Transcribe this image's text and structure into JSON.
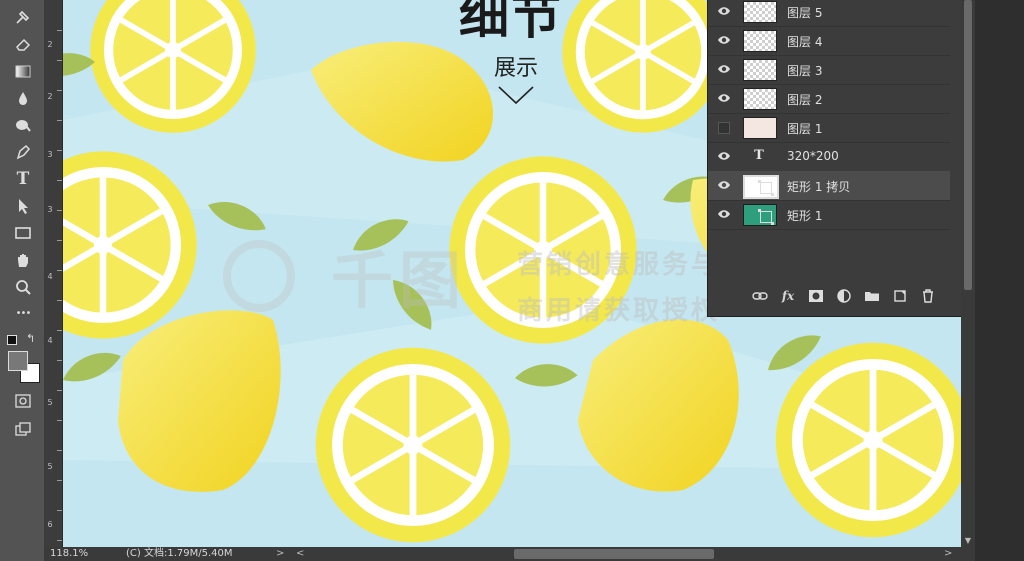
{
  "canvas": {
    "headline": "细节",
    "subline": "展示",
    "watermark_main": "千图",
    "watermark_sub1": "营销创意服务与协作平台",
    "watermark_sub2": "商用请获取授权"
  },
  "ruler": {
    "labels": [
      "2",
      "2",
      "3",
      "3",
      "4",
      "4",
      "5",
      "5",
      "6"
    ]
  },
  "layers_panel": {
    "rows": [
      {
        "name": "图层 5",
        "thumb": "transparent",
        "visible": true
      },
      {
        "name": "图层 4",
        "thumb": "transparent",
        "visible": true
      },
      {
        "name": "图层 3",
        "thumb": "transparent",
        "visible": true
      },
      {
        "name": "图层 2",
        "thumb": "transparent",
        "visible": true
      },
      {
        "name": "图层 1",
        "thumb": "photo",
        "visible": false
      },
      {
        "name": "320*200",
        "thumb": "text",
        "visible": true,
        "thumb_text": "T"
      },
      {
        "name": "矩形 1 拷贝",
        "thumb": "white",
        "visible": true,
        "selected": true
      },
      {
        "name": "矩形 1",
        "thumb": "teal",
        "visible": true
      }
    ],
    "footer_icons": [
      "link-icon",
      "fx-icon",
      "mask-icon",
      "adjustment-icon",
      "folder-icon",
      "new-layer-icon",
      "trash-icon"
    ],
    "fx_label": "fx"
  },
  "status": {
    "zoom": "118.1%",
    "doc_info": "(C) 文档:1.79M/5.40M",
    "more": ">",
    "scroll_left": "<",
    "scroll_right": ">"
  },
  "tools": [
    "brush-icon",
    "eraser-icon",
    "gradient-icon",
    "blur-icon",
    "dodge-icon",
    "pen-icon",
    "type-icon",
    "path-select-icon",
    "rectangle-icon",
    "hand-icon",
    "zoom-icon",
    "more-icon"
  ],
  "tool_glyphs": {
    "type": "T",
    "more": "•••"
  }
}
